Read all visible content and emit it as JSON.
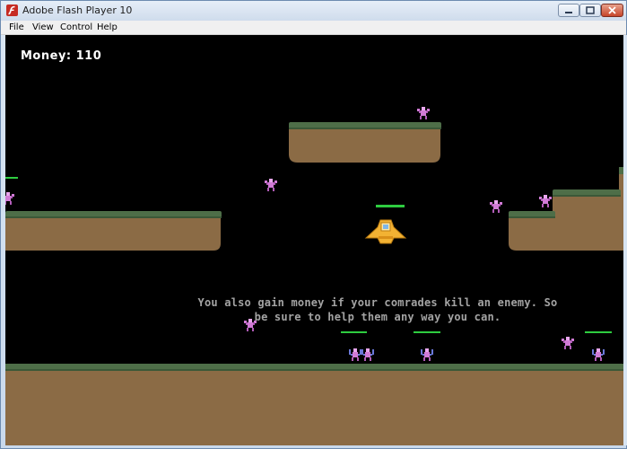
{
  "window": {
    "title": "Adobe Flash Player 10",
    "buttons": {
      "minimize": "minimize-icon",
      "maximize": "maximize-icon",
      "close": "close-icon"
    }
  },
  "menu": {
    "items": [
      "File",
      "View",
      "Control",
      "Help"
    ]
  },
  "game": {
    "money_label": "Money: 110",
    "tutorial_line1": "You also gain money if your comrades kill an enemy. So",
    "tutorial_line2": "be sure to help them any way you can.",
    "colors": {
      "background": "#000000",
      "grass": "#4e6e48",
      "dirt": "#8b6b45",
      "health": "#2ecc40",
      "ship": "#f2b233",
      "enemy": "#d17bd6",
      "comrade": "#6a78d8",
      "tutorial_text": "#a3a3a3"
    }
  }
}
